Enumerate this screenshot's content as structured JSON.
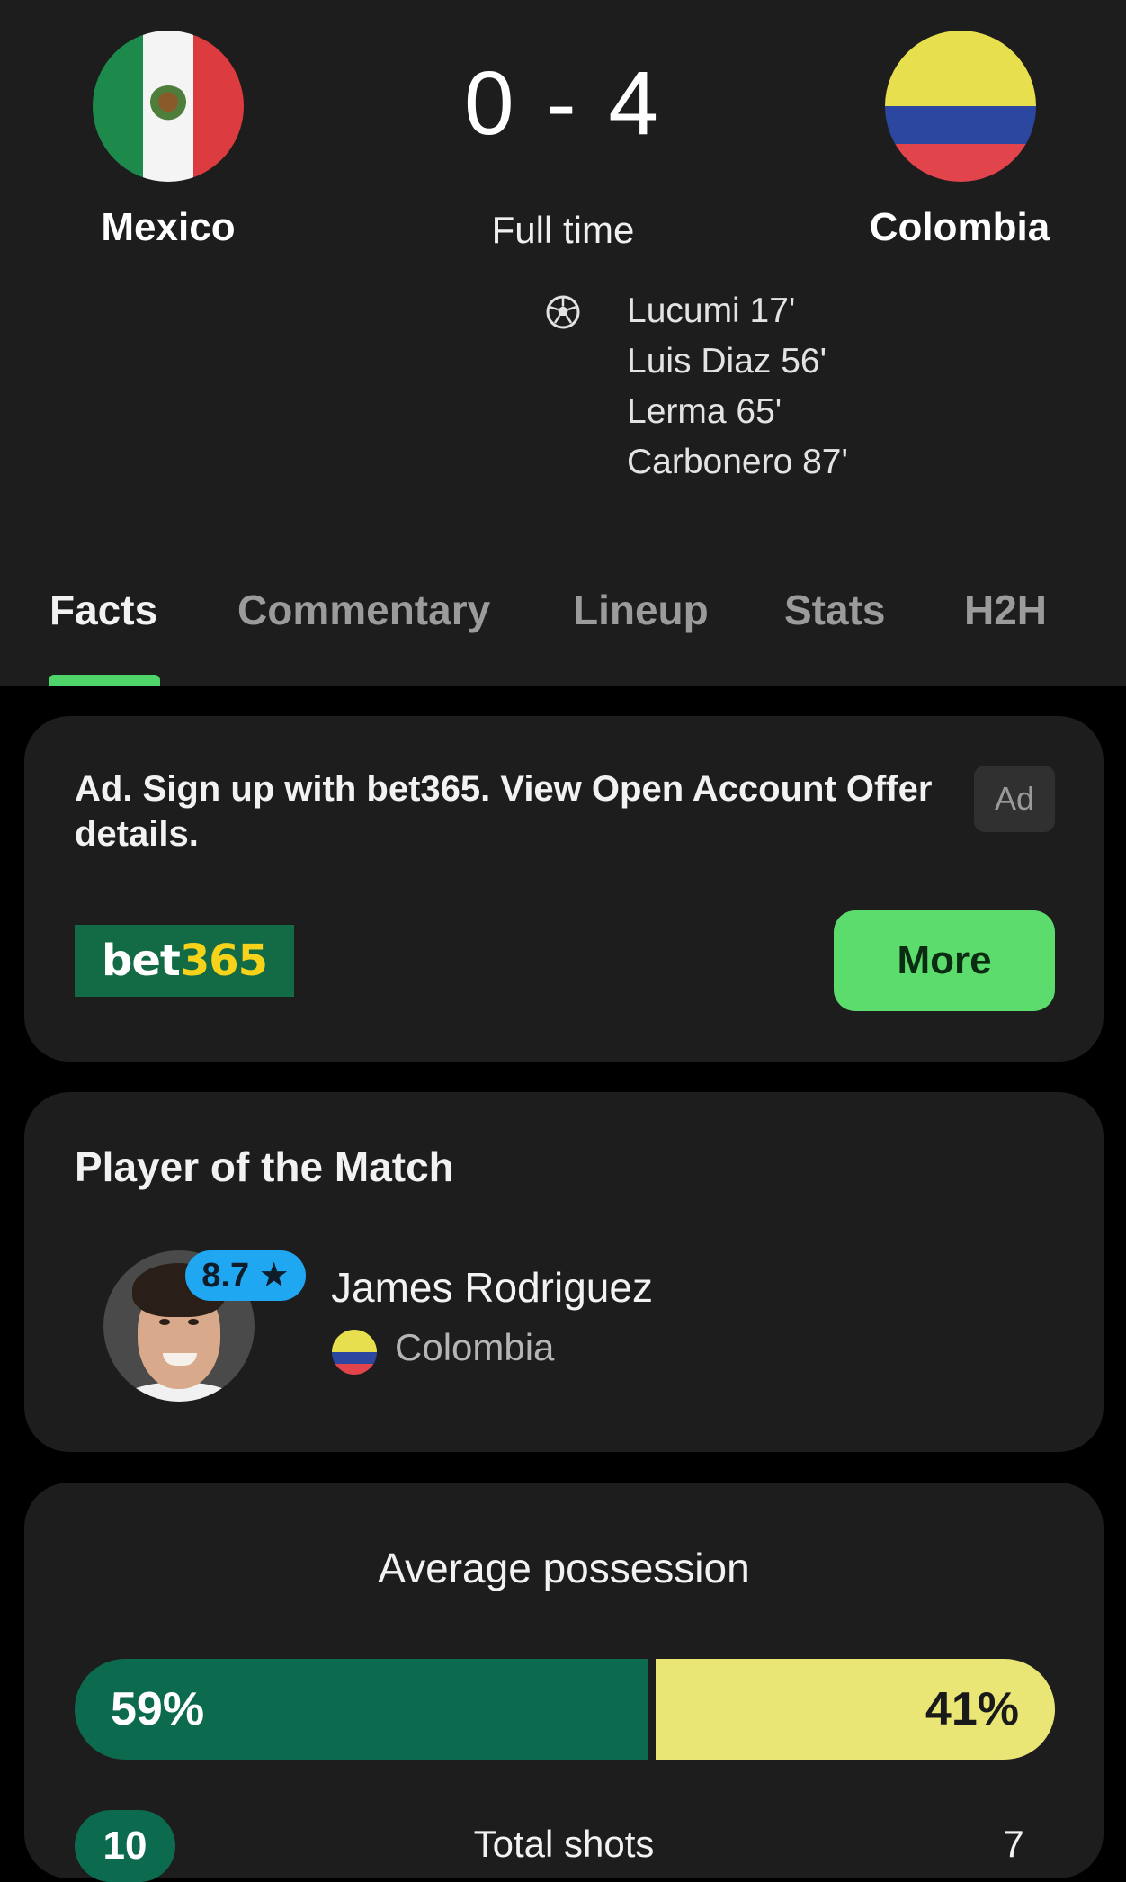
{
  "match": {
    "home_team": "Mexico",
    "away_team": "Colombia",
    "score": "0 - 4",
    "status": "Full time",
    "scorers": [
      "Lucumi 17'",
      "Luis Diaz 56'",
      "Lerma 65'",
      "Carbonero 87'"
    ],
    "colors": {
      "mexico_green": "#1d8a4c",
      "mexico_red": "#dc3b3f",
      "colombia_yellow": "#e7df4d",
      "colombia_blue": "#2c47a0",
      "colombia_red": "#e2444b"
    }
  },
  "tabs": [
    {
      "label": "Facts",
      "active": true
    },
    {
      "label": "Commentary",
      "active": false
    },
    {
      "label": "Lineup",
      "active": false
    },
    {
      "label": "Stats",
      "active": false
    },
    {
      "label": "H2H",
      "active": false
    }
  ],
  "accent_color": "#4fd46a",
  "ad": {
    "text": "Ad. Sign up with bet365. View Open Account Offer details.",
    "badge": "Ad",
    "logo_bet": "bet",
    "logo_num": "365",
    "more_label": "More"
  },
  "player_of_match": {
    "title": "Player of the Match",
    "rating": "8.7",
    "name": "James Rodriguez",
    "team": "Colombia"
  },
  "stats": {
    "possession_title": "Average possession",
    "possession_home_pct": 59,
    "possession_away_pct": 41,
    "possession_home_label": "59%",
    "possession_away_label": "41%",
    "shots_label": "Total shots",
    "shots_home": "10",
    "shots_away": "7"
  }
}
